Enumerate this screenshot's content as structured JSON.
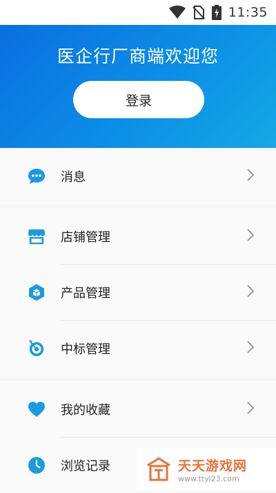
{
  "status_bar": {
    "time": "11:35",
    "icons": [
      "wifi-icon",
      "no-sim-icon",
      "battery-charging-icon"
    ]
  },
  "header": {
    "welcome": "医企行厂商端欢迎您",
    "login_label": "登录",
    "gradient_colors": [
      "#0a6fe0",
      "#14a9e4"
    ]
  },
  "menu": {
    "accent_color": "#1a9be0",
    "sections": [
      {
        "items": [
          {
            "label": "消息",
            "icon": "chat-bubble-icon"
          }
        ]
      },
      {
        "items": [
          {
            "label": "店铺管理",
            "icon": "store-icon"
          },
          {
            "label": "产品管理",
            "icon": "hexagon-box-icon"
          },
          {
            "label": "中标管理",
            "icon": "target-icon"
          }
        ]
      },
      {
        "items": [
          {
            "label": "我的收藏",
            "icon": "heart-icon"
          },
          {
            "label": "浏览记录",
            "icon": "clock-icon"
          }
        ]
      }
    ]
  },
  "watermark": {
    "title": "天天游戏网",
    "url": "www.ttyl23.com"
  }
}
